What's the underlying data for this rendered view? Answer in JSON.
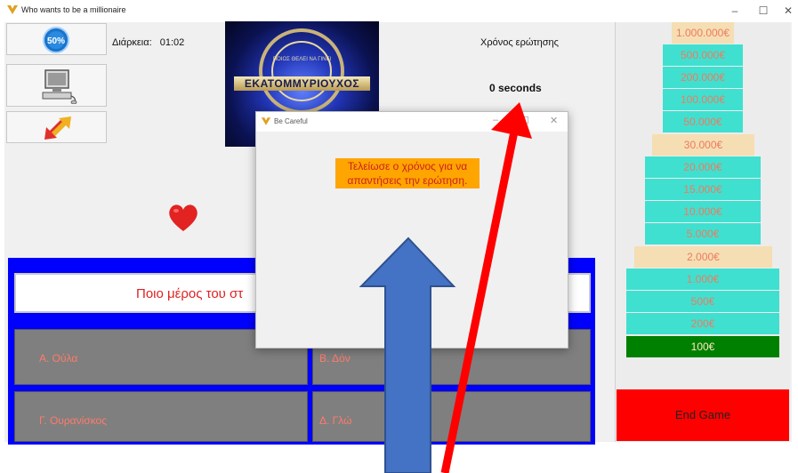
{
  "window": {
    "title": "Who wants to be a millionaire",
    "controls": {
      "minimize": "–",
      "maximize": "☐",
      "close": "✕"
    }
  },
  "lifelines": [
    {
      "name": "fifty-fifty",
      "label": "50%",
      "icon": "fifty-fifty-icon"
    },
    {
      "name": "ask-computer",
      "icon": "computer-icon"
    },
    {
      "name": "switch-question",
      "icon": "swap-arrows-icon"
    }
  ],
  "status": {
    "duration_label": "Διάρκεια:",
    "duration_value": "01:02",
    "question_time_label": "Χρόνος ερώτησης",
    "seconds": "0 seconds"
  },
  "logo": {
    "text": "ΕΚΑΤΟΜΜΥΡΙΟΥΧΟΣ",
    "arc_text": "ΠΟΙΟΣ ΘΕΛΕΙ ΝΑ ΓΙΝΕΙ"
  },
  "question": {
    "text": "Ποιο μέρος του στ"
  },
  "answers": [
    {
      "key": "A",
      "text": "Α. Ούλα"
    },
    {
      "key": "B",
      "text": "Β. Δόν"
    },
    {
      "key": "C",
      "text": "Γ. Ουρανίσκος"
    },
    {
      "key": "D",
      "text": "Δ. Γλώ"
    }
  ],
  "prizes": [
    {
      "label": "1.000.000€",
      "style": "wheat"
    },
    {
      "label": "500.000€",
      "style": "aqua"
    },
    {
      "label": "200.000€",
      "style": "aqua"
    },
    {
      "label": "100.000€",
      "style": "aqua"
    },
    {
      "label": "50.000€",
      "style": "aqua"
    },
    {
      "label": "30.000€",
      "style": "wheat"
    },
    {
      "label": "20.000€",
      "style": "aqua"
    },
    {
      "label": "15.000€",
      "style": "aqua"
    },
    {
      "label": "10.000€",
      "style": "aqua"
    },
    {
      "label": "5.000€",
      "style": "aqua"
    },
    {
      "label": "2.000€",
      "style": "wheat"
    },
    {
      "label": "1.000€",
      "style": "aqua"
    },
    {
      "label": "500€",
      "style": "aqua"
    },
    {
      "label": "200€",
      "style": "aqua"
    },
    {
      "label": "100€",
      "style": "green"
    }
  ],
  "end_game": "End Game",
  "dialog": {
    "title": "Be Careful",
    "message_line1": "Τελείωσε ο χρόνος για να",
    "message_line2": "απαντήσεις την ερώτηση."
  },
  "colors": {
    "board_blue": "#0000ff",
    "answer_gray": "#7f7f7f",
    "prize_aqua": "#40e0d0",
    "prize_wheat": "#f5deb3",
    "prize_current": "#008000",
    "end_game_red": "#ff0000",
    "dialog_message_bg": "#ffa500",
    "arrow_blue": "#4472c4",
    "arrow_red": "#ff0000"
  }
}
